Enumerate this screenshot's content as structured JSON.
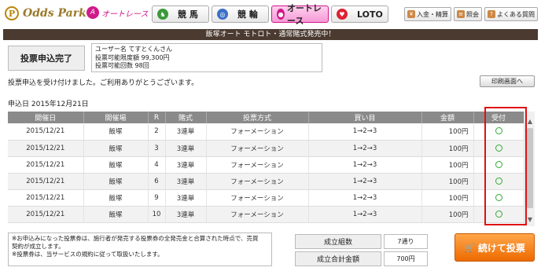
{
  "brand": {
    "logo_letter": "P",
    "logo_text": "Odds Park",
    "sub_text": "オートレース",
    "sub_mark": "A"
  },
  "tabs": [
    {
      "label": "競 馬",
      "icon": "horse-icon",
      "glyph": "♞"
    },
    {
      "label": "競 輪",
      "icon": "bicycle-icon",
      "glyph": "◎"
    },
    {
      "label": "オートレース",
      "icon": "motorbike-icon",
      "glyph": "●"
    },
    {
      "label": "LOTO",
      "icon": "loto-icon",
      "glyph": "♥"
    }
  ],
  "util": [
    {
      "label": "入金・精算",
      "icon": "deposit-icon"
    },
    {
      "label": "照会",
      "icon": "inquiry-icon"
    },
    {
      "label": "よくある質問",
      "icon": "faq-icon"
    }
  ],
  "banner": "飯塚オート モトロト・通常賭式発売中！",
  "complete_label": "投票申込完了",
  "user": {
    "line1": "ユーザー名 てすとくんさん",
    "line2": "投票可能限度額 99,300円",
    "line3": "投票可能回数 98回"
  },
  "message": "投票申込を受け付けました。ご利用ありがとうございます。",
  "print_label": "印刷画面へ",
  "date_line": "申込日 2015年12月21日",
  "table": {
    "headers": [
      "開催日",
      "開催場",
      "R",
      "賭式",
      "投票方式",
      "買い目",
      "金額",
      "受付"
    ],
    "rows": [
      {
        "date": "2015/12/21",
        "venue": "飯塚",
        "race": "2",
        "bet": "3連単",
        "method": "フォーメーション",
        "pick": "1→2→3",
        "amount": "100円"
      },
      {
        "date": "2015/12/21",
        "venue": "飯塚",
        "race": "3",
        "bet": "3連単",
        "method": "フォーメーション",
        "pick": "1→2→3",
        "amount": "100円"
      },
      {
        "date": "2015/12/21",
        "venue": "飯塚",
        "race": "4",
        "bet": "3連単",
        "method": "フォーメーション",
        "pick": "1→2→3",
        "amount": "100円"
      },
      {
        "date": "2015/12/21",
        "venue": "飯塚",
        "race": "6",
        "bet": "3連単",
        "method": "フォーメーション",
        "pick": "1→2→3",
        "amount": "100円"
      },
      {
        "date": "2015/12/21",
        "venue": "飯塚",
        "race": "9",
        "bet": "3連単",
        "method": "フォーメーション",
        "pick": "1→2→3",
        "amount": "100円"
      },
      {
        "date": "2015/12/21",
        "venue": "飯塚",
        "race": "10",
        "bet": "3連単",
        "method": "フォーメーション",
        "pick": "1→2→3",
        "amount": "100円"
      }
    ],
    "accepted_mark": "○"
  },
  "note": {
    "line1": "※お申込みになった投票券は、施行者が発売する投票券の全発売金と合算された時点で、売買",
    "line2": "契約が成立します。",
    "line3": "※投票券は、当サービスの規約に従って取扱いたします。"
  },
  "summary": {
    "count_label": "成立組数",
    "count_value": "7通り",
    "total_label": "成立合計金額",
    "total_value": "700円"
  },
  "continue_label": "続けて投票",
  "colors": {
    "accent": "#d0188a",
    "banner": "#4a3a30",
    "button": "#ee6a00",
    "highlight": "#e01010",
    "accepted": "#33aa33"
  }
}
